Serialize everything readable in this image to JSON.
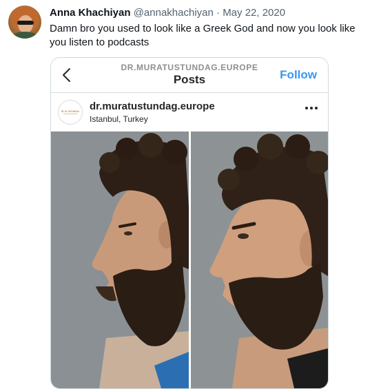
{
  "tweet": {
    "author_name": "Anna Khachiyan",
    "handle": "@annakhachiyan",
    "separator": "·",
    "date": "May 22, 2020",
    "text": "Damn bro you used to look like a Greek God and now you look like you listen to podcasts"
  },
  "instagram": {
    "top_username": "DR.MURATUSTUNDAG.EUROPE",
    "title": "Posts",
    "follow_label": "Follow",
    "post_username": "dr.muratustundag.europe",
    "post_location": "Istanbul, Turkey",
    "avatar_logo_text": "DR. M. USTUNDAG",
    "images": [
      "profile-before-photo",
      "profile-after-photo"
    ]
  },
  "colors": {
    "text_primary": "#0f1419",
    "text_secondary": "#536471",
    "follow_blue": "#3897f0",
    "card_border": "#cfd9de",
    "photo_background": "#8a8f92"
  }
}
